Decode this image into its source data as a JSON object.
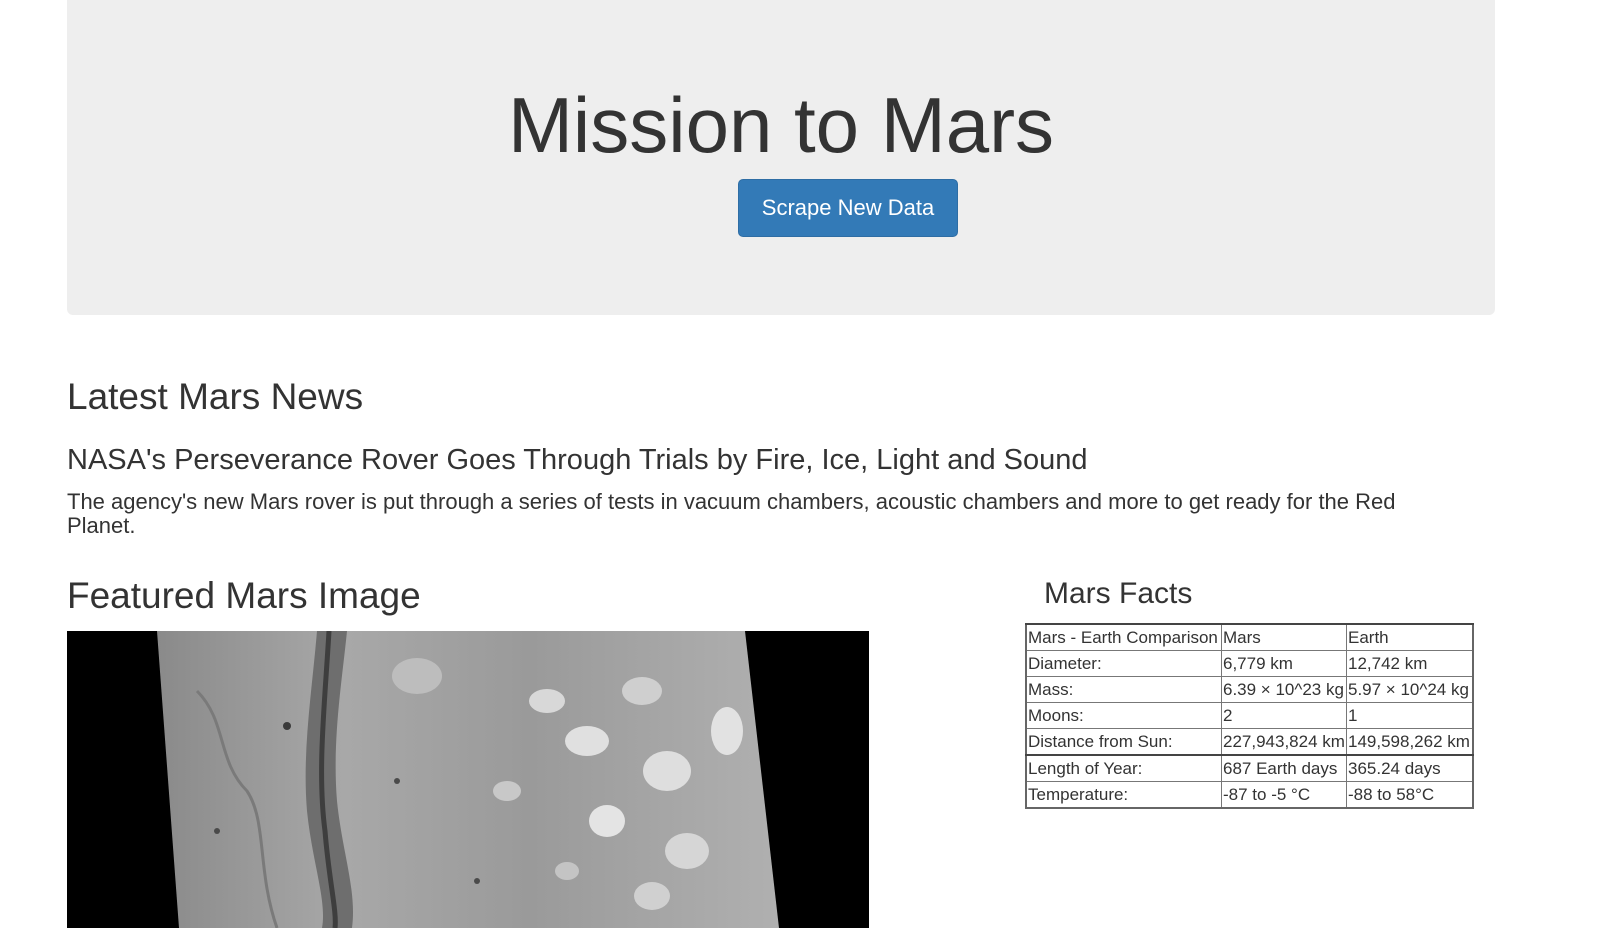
{
  "header": {
    "title": "Mission to Mars",
    "scrape_button_label": "Scrape New Data"
  },
  "news": {
    "heading": "Latest Mars News",
    "title": "NASA's Perseverance Rover Goes Through Trials by Fire, Ice, Light and Sound",
    "body": "The agency's new Mars rover is put through a series of tests in vacuum chambers, acoustic chambers and more to get ready for the Red Planet."
  },
  "featured_image": {
    "heading": "Featured Mars Image"
  },
  "facts": {
    "heading": "Mars Facts",
    "columns": [
      "Mars - Earth Comparison",
      "Mars",
      "Earth"
    ],
    "rows": [
      [
        "Diameter:",
        "6,779 km",
        "12,742 km"
      ],
      [
        "Mass:",
        "6.39 × 10^23 kg",
        "5.97 × 10^24 kg"
      ],
      [
        "Moons:",
        "2",
        "1"
      ],
      [
        "Distance from Sun:",
        "227,943,824 km",
        "149,598,262 km"
      ],
      [
        "Length of Year:",
        "687 Earth days",
        "365.24 days"
      ],
      [
        "Temperature:",
        "-87 to -5 °C",
        "-88 to 58°C"
      ]
    ]
  },
  "colors": {
    "jumbotron_bg": "#eeeeee",
    "button_bg": "#337ab7",
    "text": "#333333"
  }
}
